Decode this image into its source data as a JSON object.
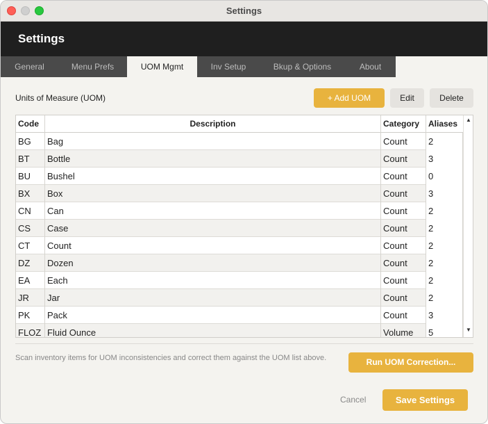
{
  "window": {
    "title": "Settings"
  },
  "header": {
    "title": "Settings"
  },
  "tabs": [
    {
      "label": "General"
    },
    {
      "label": "Menu Prefs"
    },
    {
      "label": "UOM Mgmt"
    },
    {
      "label": "Inv Setup"
    },
    {
      "label": "Bkup & Options"
    },
    {
      "label": "About"
    }
  ],
  "uom": {
    "section_label": "Units of Measure  (UOM)",
    "add_label": "+ Add UOM",
    "edit_label": "Edit",
    "delete_label": "Delete",
    "columns": {
      "code": "Code",
      "description": "Description",
      "category": "Category",
      "aliases": "Aliases"
    },
    "rows": [
      {
        "code": "BG",
        "description": "Bag",
        "category": "Count",
        "aliases": "2"
      },
      {
        "code": "BT",
        "description": "Bottle",
        "category": "Count",
        "aliases": "3"
      },
      {
        "code": "BU",
        "description": "Bushel",
        "category": "Count",
        "aliases": "0"
      },
      {
        "code": "BX",
        "description": "Box",
        "category": "Count",
        "aliases": "3"
      },
      {
        "code": "CN",
        "description": "Can",
        "category": "Count",
        "aliases": "2"
      },
      {
        "code": "CS",
        "description": "Case",
        "category": "Count",
        "aliases": "2"
      },
      {
        "code": "CT",
        "description": "Count",
        "category": "Count",
        "aliases": "2"
      },
      {
        "code": "DZ",
        "description": "Dozen",
        "category": "Count",
        "aliases": "2"
      },
      {
        "code": "EA",
        "description": "Each",
        "category": "Count",
        "aliases": "2"
      },
      {
        "code": "JR",
        "description": "Jar",
        "category": "Count",
        "aliases": "2"
      },
      {
        "code": "PK",
        "description": "Pack",
        "category": "Count",
        "aliases": "3"
      },
      {
        "code": "FLOZ",
        "description": "Fluid Ounce",
        "category": "Volume",
        "aliases": "5"
      }
    ]
  },
  "correction": {
    "text": "Scan inventory items for UOM inconsistencies and correct them against the UOM list above.",
    "run_label": "Run UOM Correction..."
  },
  "footer": {
    "cancel_label": "Cancel",
    "save_label": "Save Settings"
  },
  "colors": {
    "accent": "#e8b33e",
    "header_bg": "#1f1f1f",
    "tab_strip": "#4a4a4a"
  }
}
